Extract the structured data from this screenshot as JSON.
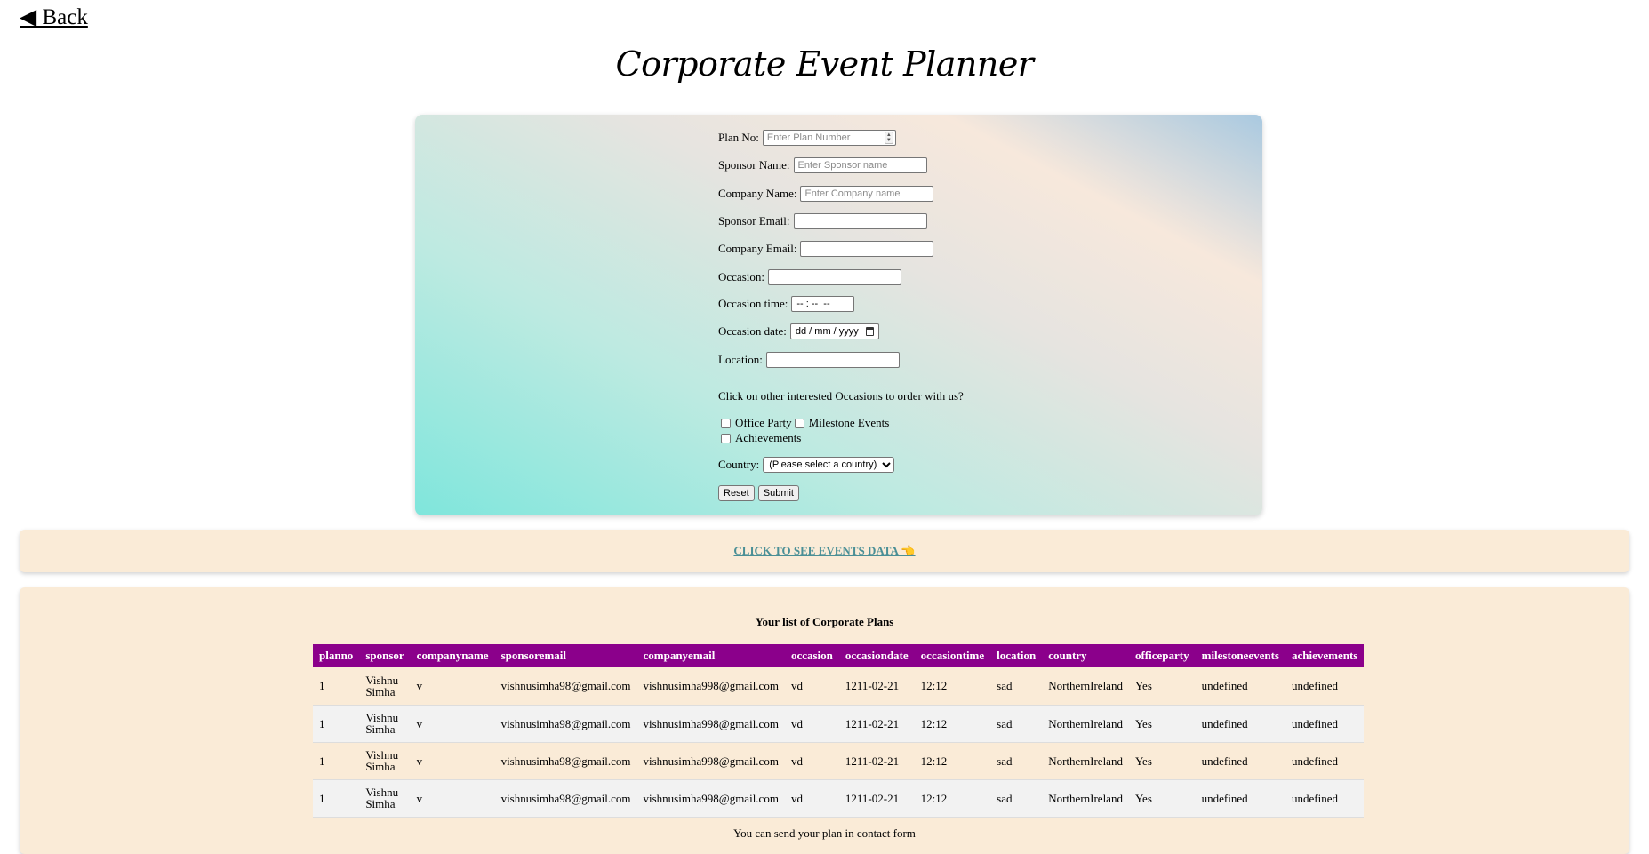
{
  "nav": {
    "back_label": "◀ Back"
  },
  "page": {
    "title": "Corporate Event Planner"
  },
  "form": {
    "plan_no": {
      "label": "Plan No:",
      "placeholder": "Enter Plan Number",
      "value": ""
    },
    "sponsor_name": {
      "label": "Sponsor Name:",
      "placeholder": "Enter Sponsor name",
      "value": ""
    },
    "company_name": {
      "label": "Company Name:",
      "placeholder": "Enter Company name",
      "value": ""
    },
    "sponsor_email": {
      "label": "Sponsor Email:",
      "value": ""
    },
    "company_email": {
      "label": "Company Email:",
      "value": ""
    },
    "occasion": {
      "label": "Occasion:",
      "value": ""
    },
    "occasion_time": {
      "label": "Occasion time:",
      "display": "-- : --  --"
    },
    "occasion_date": {
      "label": "Occasion date:",
      "display": "dd / mm / yyyy"
    },
    "location": {
      "label": "Location:",
      "value": ""
    },
    "interest_prompt": "Click on other interested Occasions to order with us?",
    "checkboxes": [
      {
        "label": "Office Party",
        "checked": false
      },
      {
        "label": "Milestone Events",
        "checked": false
      },
      {
        "label": "Achievements",
        "checked": false
      }
    ],
    "country": {
      "label": "Country:",
      "selected": "(Please select a country)"
    },
    "reset_label": "Reset",
    "submit_label": "Submit"
  },
  "events_link": {
    "label": "CLICK TO SEE EVENTS DATA 👈"
  },
  "plans": {
    "caption": "Your list of Corporate Plans",
    "columns": [
      "planno",
      "sponsor",
      "companyname",
      "sponsoremail",
      "companyemail",
      "occasion",
      "occasiondate",
      "occasiontime",
      "location",
      "country",
      "officeparty",
      "milestoneevents",
      "achievements"
    ],
    "rows": [
      [
        "1",
        "Vishnu Simha",
        "v",
        "vishnusimha98@gmail.com",
        "vishnusimha998@gmail.com",
        "vd",
        "1211-02-21",
        "12:12",
        "sad",
        "NorthernIreland",
        "Yes",
        "undefined",
        "undefined"
      ],
      [
        "1",
        "Vishnu Simha",
        "v",
        "vishnusimha98@gmail.com",
        "vishnusimha998@gmail.com",
        "vd",
        "1211-02-21",
        "12:12",
        "sad",
        "NorthernIreland",
        "Yes",
        "undefined",
        "undefined"
      ],
      [
        "1",
        "Vishnu Simha",
        "v",
        "vishnusimha98@gmail.com",
        "vishnusimha998@gmail.com",
        "vd",
        "1211-02-21",
        "12:12",
        "sad",
        "NorthernIreland",
        "Yes",
        "undefined",
        "undefined"
      ],
      [
        "1",
        "Vishnu Simha",
        "v",
        "vishnusimha98@gmail.com",
        "vishnusimha998@gmail.com",
        "vd",
        "1211-02-21",
        "12:12",
        "sad",
        "NorthernIreland",
        "Yes",
        "undefined",
        "undefined"
      ]
    ],
    "footer_note": "You can send your plan in contact form"
  },
  "colors": {
    "table_header_bg": "#8b008b",
    "panel_bg": "#faebd7",
    "link_color": "#4a8f96"
  }
}
